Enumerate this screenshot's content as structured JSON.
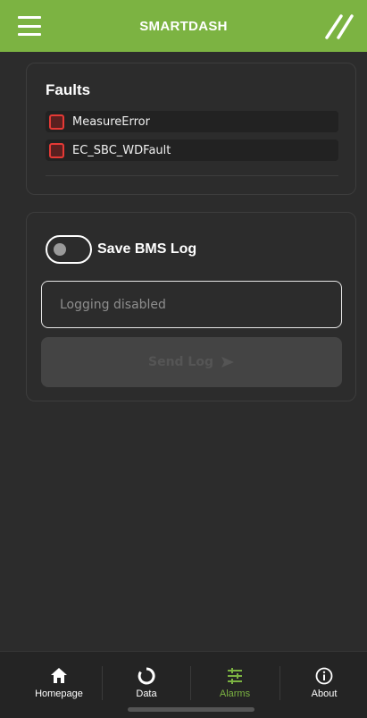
{
  "header": {
    "title": "SMARTDASH",
    "menu_icon": "hamburger-menu-icon",
    "logo_icon": "smartdash-logo-icon",
    "background_color": "#7cb342"
  },
  "faults": {
    "title": "Faults",
    "items": [
      {
        "label": "MeasureError",
        "status_color": "#e53935"
      },
      {
        "label": "EC_SBC_WDFault",
        "status_color": "#e53935"
      }
    ]
  },
  "log": {
    "toggle_label": "Save BMS Log",
    "toggle_on": false,
    "field_placeholder": "Logging disabled",
    "send_label": "Send Log",
    "send_icon": "send-arrow-icon",
    "send_enabled": false
  },
  "tabs": [
    {
      "label": "Homepage",
      "icon": "home-icon",
      "active": false
    },
    {
      "label": "Data",
      "icon": "loading-circle-icon",
      "active": false
    },
    {
      "label": "Alarms",
      "icon": "sliders-icon",
      "active": true
    },
    {
      "label": "About",
      "icon": "info-icon",
      "active": false
    }
  ],
  "theme": {
    "accent": "#7cb342",
    "background": "#2c2c2c",
    "fault_red": "#e53935"
  }
}
